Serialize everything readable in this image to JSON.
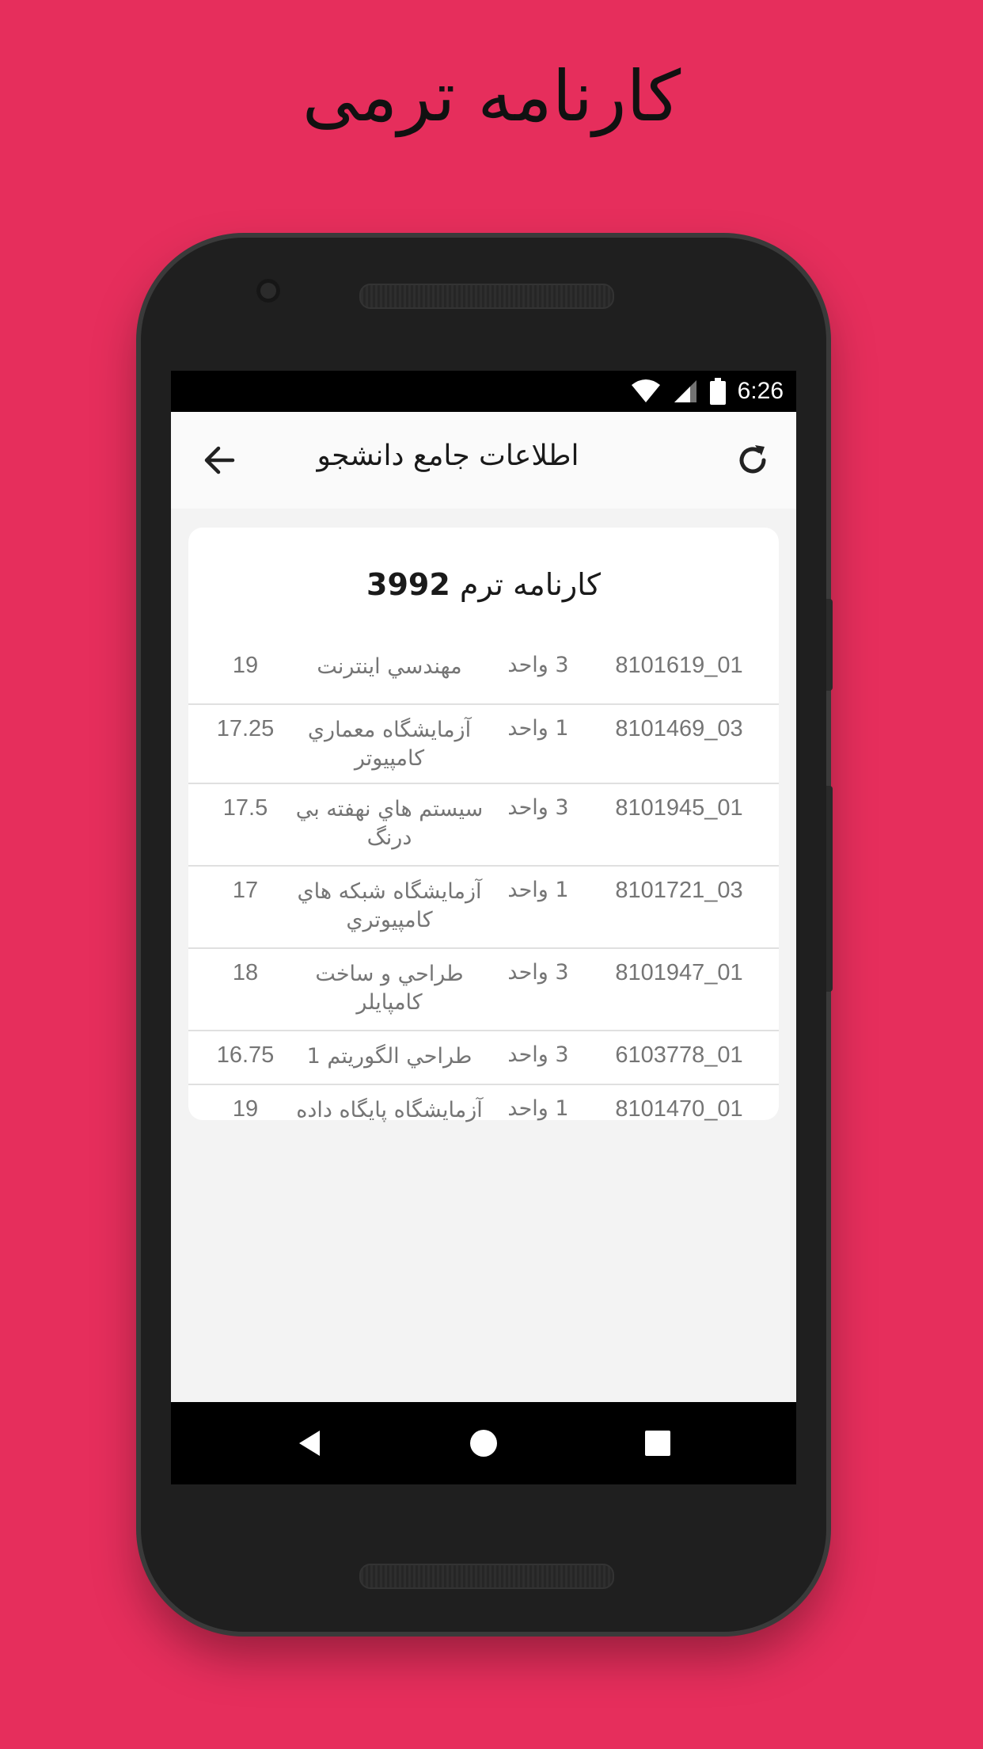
{
  "promo": {
    "title": "کارنامه ترمی"
  },
  "status_bar": {
    "time": "6:26"
  },
  "app_bar": {
    "title": "اطلاعات جامع دانشجو"
  },
  "card": {
    "title_text": "کارنامه ترم",
    "term_number": "3992",
    "courses": [
      {
        "code": "8101619_01",
        "units": "3 واحد",
        "name": "مهندسي اينترنت",
        "grade": "19"
      },
      {
        "code": "8101469_03",
        "units": "1 واحد",
        "name": "آزمايشگاه معماري كامپيوتر",
        "grade": "17.25"
      },
      {
        "code": "8101945_01",
        "units": "3 واحد",
        "name": "سيستم هاي نهفته بي درنگ",
        "grade": "17.5"
      },
      {
        "code": "8101721_03",
        "units": "1 واحد",
        "name": "آزمايشگاه شبكه هاي كامپيوتري",
        "grade": "17"
      },
      {
        "code": "8101947_01",
        "units": "3 واحد",
        "name": "طراحي و ساخت كامپايلر",
        "grade": "18"
      },
      {
        "code": "6103778_01",
        "units": "3 واحد",
        "name": "طراحي الگوريتم 1",
        "grade": "16.75"
      },
      {
        "code": "8101470_01",
        "units": "1 واحد",
        "name": "آزمايشگاه پايگاه داده",
        "grade": "19"
      }
    ]
  },
  "icons": {
    "back": "arrow-left-icon",
    "refresh": "refresh-icon",
    "wifi": "wifi-icon",
    "signal": "signal-icon",
    "battery": "battery-icon",
    "nav_back": "triangle-back-icon",
    "nav_home": "circle-home-icon",
    "nav_recents": "square-recents-icon"
  },
  "colors": {
    "background": "#e62e5c",
    "phone_body": "#1f1f1f",
    "screen": "#f3f3f3",
    "card": "#ffffff",
    "row_text": "#757575"
  }
}
